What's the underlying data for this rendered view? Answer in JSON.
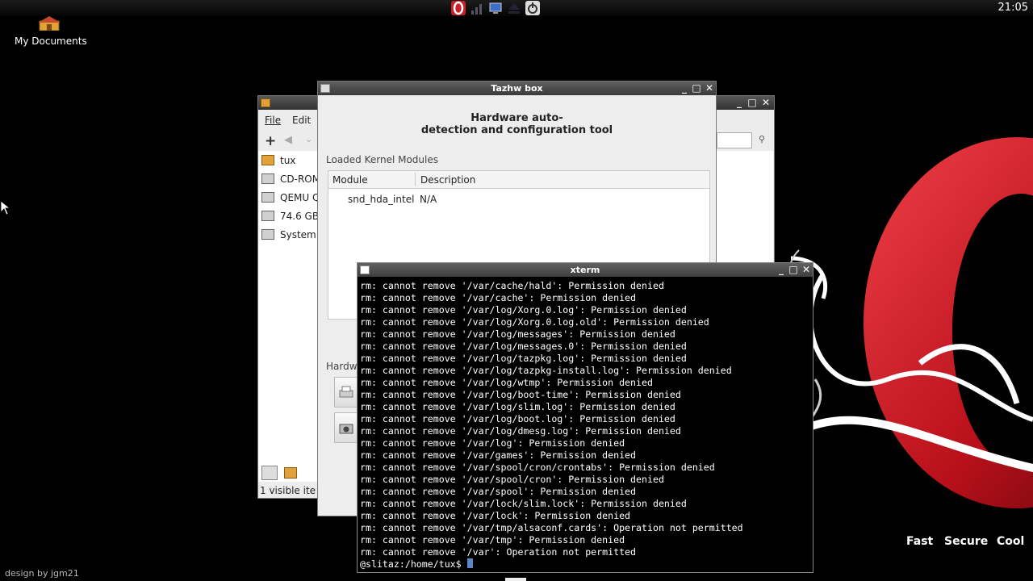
{
  "panel": {
    "clock": "21:05",
    "tray_icons": [
      "opera-icon",
      "network-signal-icon",
      "monitor-icon",
      "eject-icon",
      "power-icon"
    ]
  },
  "desktop": {
    "icon_label": "My Documents",
    "credit": "design by jgm21",
    "taglines": [
      "Fast",
      "Secure",
      "Cool"
    ]
  },
  "file_manager": {
    "menu": [
      "File",
      "Edit"
    ],
    "side_items": [
      "tux",
      "CD-ROM",
      "QEMU Q",
      "74.6 GB",
      "System"
    ],
    "status": "1 visible ite"
  },
  "tazhw": {
    "title": "Tazhw box",
    "heading_line1": "Hardware auto-",
    "heading_line2": "detection and configuration tool",
    "section": "Loaded Kernel Modules",
    "columns": [
      "Module",
      "Description"
    ],
    "rows": [
      [
        "snd_hda_intel",
        "N/A"
      ]
    ],
    "hw_label": "Hardw"
  },
  "xterm": {
    "title": "xterm",
    "lines": [
      "rm: cannot remove '/var/cache/hald': Permission denied",
      "rm: cannot remove '/var/cache': Permission denied",
      "rm: cannot remove '/var/log/Xorg.0.log': Permission denied",
      "rm: cannot remove '/var/log/Xorg.0.log.old': Permission denied",
      "rm: cannot remove '/var/log/messages': Permission denied",
      "rm: cannot remove '/var/log/messages.0': Permission denied",
      "rm: cannot remove '/var/log/tazpkg.log': Permission denied",
      "rm: cannot remove '/var/log/tazpkg-install.log': Permission denied",
      "rm: cannot remove '/var/log/wtmp': Permission denied",
      "rm: cannot remove '/var/log/boot-time': Permission denied",
      "rm: cannot remove '/var/log/slim.log': Permission denied",
      "rm: cannot remove '/var/log/boot.log': Permission denied",
      "rm: cannot remove '/var/log/dmesg.log': Permission denied",
      "rm: cannot remove '/var/log': Permission denied",
      "rm: cannot remove '/var/games': Permission denied",
      "rm: cannot remove '/var/spool/cron/crontabs': Permission denied",
      "rm: cannot remove '/var/spool/cron': Permission denied",
      "rm: cannot remove '/var/spool': Permission denied",
      "rm: cannot remove '/var/lock/slim.lock': Permission denied",
      "rm: cannot remove '/var/lock': Permission denied",
      "rm: cannot remove '/var/tmp/alsaconf.cards': Operation not permitted",
      "rm: cannot remove '/var/tmp': Permission denied",
      "rm: cannot remove '/var': Operation not permitted"
    ],
    "prompt": "@slitaz:/home/tux$ "
  },
  "colors": {
    "opera_red": "#d8202a",
    "terminal_bg": "#000000",
    "cursor": "#5b86c8"
  }
}
